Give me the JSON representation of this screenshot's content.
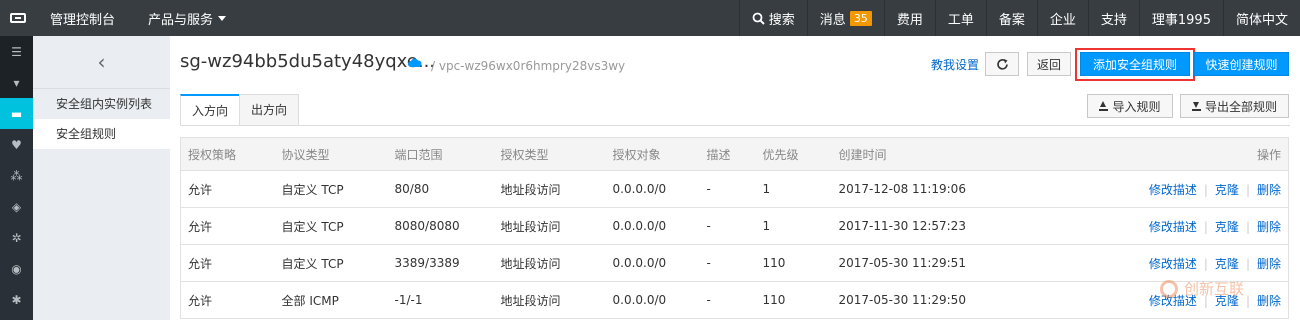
{
  "topbar": {
    "console": "管理控制台",
    "products": "产品与服务",
    "search": "搜索",
    "messages": "消息",
    "messages_count": "35",
    "billing": "费用",
    "tickets": "工单",
    "icp": "备案",
    "enterprise": "企业",
    "support": "支持",
    "account": "理事1995",
    "language": "简体中文"
  },
  "subnav": {
    "items": [
      {
        "label": "安全组内实例列表"
      },
      {
        "label": "安全组规则"
      }
    ]
  },
  "header": {
    "title": "sg-wz94bb5du5aty48yqxe...",
    "vpc": "/ vpc-wz96wx0r6hmpry28vs3wy",
    "help": "教我设置",
    "back": "返回",
    "add_rule": "添加安全组规则",
    "quick_rule": "快速创建规则"
  },
  "tabs": [
    {
      "label": "入方向"
    },
    {
      "label": "出方向"
    }
  ],
  "actions": {
    "import": "导入规则",
    "export": "导出全部规则"
  },
  "table": {
    "columns": [
      "授权策略",
      "协议类型",
      "端口范围",
      "授权类型",
      "授权对象",
      "描述",
      "优先级",
      "创建时间",
      "操作"
    ],
    "op_edit": "修改描述",
    "op_clone": "克隆",
    "op_delete": "删除",
    "rows": [
      {
        "policy": "允许",
        "protocol": "自定义 TCP",
        "ports": "80/80",
        "auth_type": "地址段访问",
        "object": "0.0.0.0/0",
        "desc": "-",
        "priority": "1",
        "created": "2017-12-08 11:19:06"
      },
      {
        "policy": "允许",
        "protocol": "自定义 TCP",
        "ports": "8080/8080",
        "auth_type": "地址段访问",
        "object": "0.0.0.0/0",
        "desc": "-",
        "priority": "1",
        "created": "2017-11-30 12:57:23"
      },
      {
        "policy": "允许",
        "protocol": "自定义 TCP",
        "ports": "3389/3389",
        "auth_type": "地址段访问",
        "object": "0.0.0.0/0",
        "desc": "-",
        "priority": "110",
        "created": "2017-05-30 11:29:51"
      },
      {
        "policy": "允许",
        "protocol": "全部 ICMP",
        "ports": "-1/-1",
        "auth_type": "地址段访问",
        "object": "0.0.0.0/0",
        "desc": "-",
        "priority": "110",
        "created": "2017-05-30 11:29:50"
      }
    ]
  },
  "watermark": "创新互联",
  "colors": {
    "primary": "#0099ff",
    "topbar": "#373d41",
    "highlight": "#e33333"
  }
}
